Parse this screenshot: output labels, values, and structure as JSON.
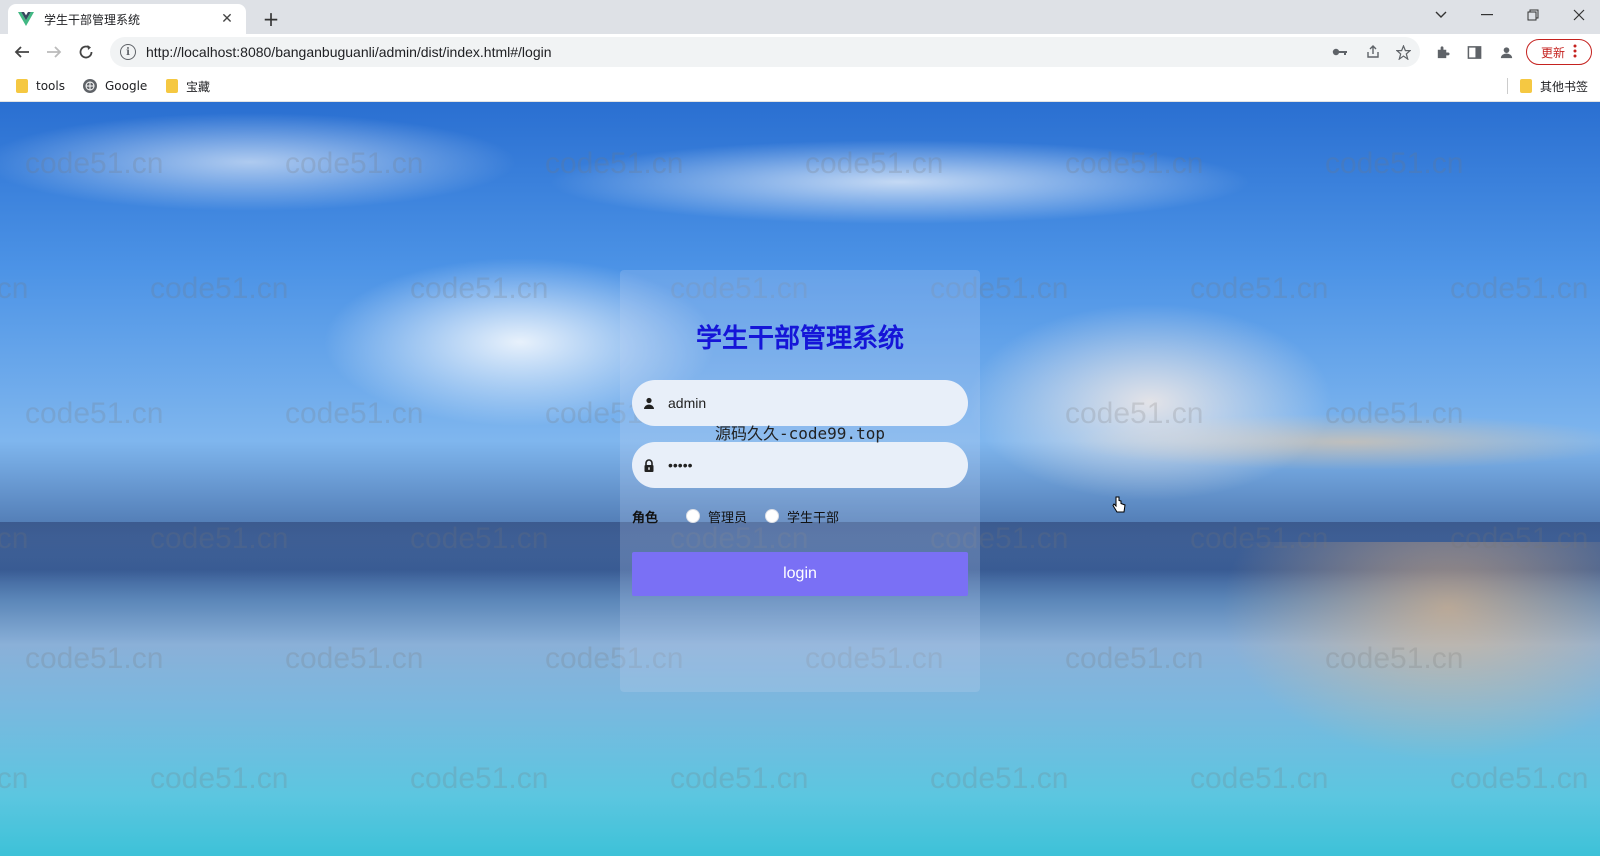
{
  "browser": {
    "tab_title": "学生干部管理系统",
    "tab_close": "✕",
    "new_tab": "+",
    "url": "http://localhost:8080/banganbuguanli/admin/dist/index.html#/login",
    "update_label": "更新",
    "bookmarks": [
      {
        "label": "tools"
      },
      {
        "label": "Google"
      },
      {
        "label": "宝藏"
      }
    ],
    "other_bookmarks": "其他书签"
  },
  "watermark_text": "code51.cn",
  "login": {
    "title": "学生干部管理系统",
    "username_value": "admin",
    "password_value": "•••••",
    "overlay_text": "源码久久-code99.top",
    "role_label": "角色",
    "roles": [
      "管理员",
      "学生干部"
    ],
    "login_label": "login"
  },
  "colors": {
    "title": "#1515d8",
    "login_button": "#7a70f5"
  }
}
